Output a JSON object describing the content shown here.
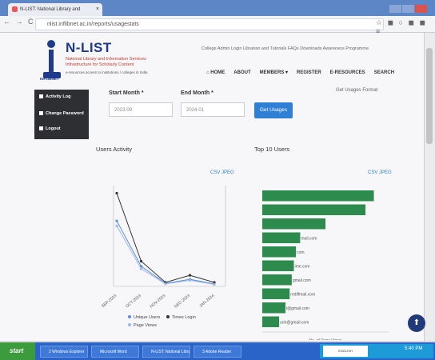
{
  "browser": {
    "tab_title": "N-LIST: National Library and",
    "tab_close": "×",
    "url": "nlist.inflibnet.ac.in/reports/usagestats",
    "nav_glyphs": "← → C",
    "toolbar_glyphs": "☆ ◼ ○ ◼ ◼ ≡"
  },
  "header": {
    "logo_title": "N-LIST",
    "logo_sub1": "National Library and Information Services",
    "logo_sub2": "Infrastructure for Scholarly Content",
    "logo_sub3": "e-resources access to institutions / colleges in India",
    "logo_badge": "INFLIBNET",
    "top_links": "College Admin Login   Librarian and Tutorials   FAQs   Downloads   Awareness Programme",
    "nav": [
      "⌂ HOME",
      "ABOUT",
      "MEMBERS ▾",
      "REGISTER",
      "E-RESOURCES",
      "SEARCH"
    ]
  },
  "sidebar": {
    "items": [
      {
        "label": "Activity Log"
      },
      {
        "label": "Change Password"
      },
      {
        "label": "Logout"
      }
    ]
  },
  "form": {
    "start_label": "Start Month *",
    "start_value": "2023-09",
    "end_label": "End Month *",
    "end_value": "2024-01",
    "button": "Get Usages",
    "format_label": "Get Usages Format"
  },
  "activity": {
    "title": "Users Activity",
    "csv_jpeg": "CSV JPEG"
  },
  "top_users": {
    "title": "Top 10 Users",
    "csv_jpeg": "CSV JPEG"
  },
  "chart_data": [
    {
      "type": "line",
      "categories": [
        "SEP-2023",
        "OCT-2023",
        "NOV-2023",
        "DEC-2023",
        "JAN-2024"
      ],
      "series": [
        {
          "name": "Unique Users",
          "values": [
            130,
            40,
            6,
            14,
            5
          ],
          "color": "#5b8fd9"
        },
        {
          "name": "Times Login",
          "values": [
            185,
            50,
            8,
            22,
            8
          ],
          "color": "#333333"
        },
        {
          "name": "Page Views",
          "values": [
            120,
            35,
            5,
            12,
            4
          ],
          "color": "#9ab8e6"
        }
      ],
      "ylim": [
        0,
        200
      ],
      "legend": "bottom"
    },
    {
      "type": "bar",
      "orientation": "horizontal",
      "categories": [
        "",
        "",
        "",
        "mail.com",
        "com",
        "ime.com",
        "gmail.com",
        "rediffmail.com",
        "l@gmail.com",
        "urie@gmail.com"
      ],
      "values": [
        265,
        245,
        150,
        90,
        80,
        75,
        70,
        65,
        55,
        40
      ],
      "xlim": [
        0,
        300
      ],
      "xlabel": "No. of Page Views",
      "color": "#2e8b4e"
    }
  ],
  "taskbar": {
    "start": "start",
    "items": [
      "2 Windows Explorer",
      "Microsoft Word",
      "N-LIST: National Libra...",
      "3 Adobe Reader"
    ],
    "tray": "ENGLISH",
    "clock": "5:40 PM"
  },
  "fab_glyph": "⬆"
}
